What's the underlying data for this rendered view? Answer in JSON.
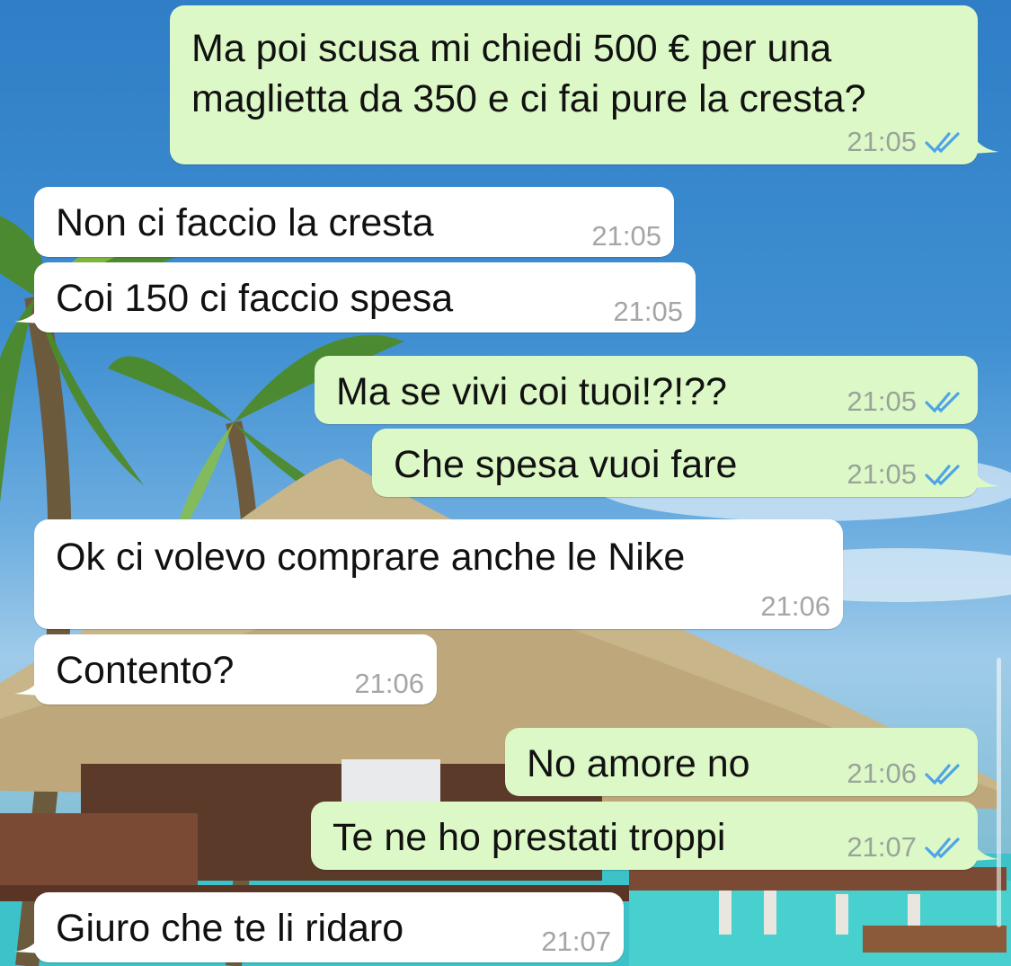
{
  "colors": {
    "outgoing_bubble": "#dcf8c6",
    "incoming_bubble": "#ffffff",
    "read_ticks": "#4fa3e8",
    "timestamp": "#9aa39a"
  },
  "messages": [
    {
      "direction": "out",
      "lines": [
        "Ma poi scusa mi chiedi 500 € per una",
        "maglietta da 350 e ci fai pure la cresta?"
      ],
      "time": "21:05",
      "status": "read"
    },
    {
      "direction": "in",
      "text": "Non ci faccio la cresta",
      "time": "21:05"
    },
    {
      "direction": "in",
      "text": "Coi 150 ci faccio spesa",
      "time": "21:05"
    },
    {
      "direction": "out",
      "text": "Ma se vivi coi tuoi!?!??",
      "time": "21:05",
      "status": "read"
    },
    {
      "direction": "out",
      "text": "Che spesa vuoi fare",
      "time": "21:05",
      "status": "read"
    },
    {
      "direction": "in",
      "text": "Ok ci volevo comprare anche le Nike",
      "time": "21:06"
    },
    {
      "direction": "in",
      "text": "Contento?",
      "time": "21:06"
    },
    {
      "direction": "out",
      "text": "No amore no",
      "time": "21:06",
      "status": "read"
    },
    {
      "direction": "out",
      "text": "Te ne ho prestati troppi",
      "time": "21:07",
      "status": "read"
    },
    {
      "direction": "in",
      "text": "Giuro che te li ridaro",
      "time": "21:07"
    }
  ]
}
